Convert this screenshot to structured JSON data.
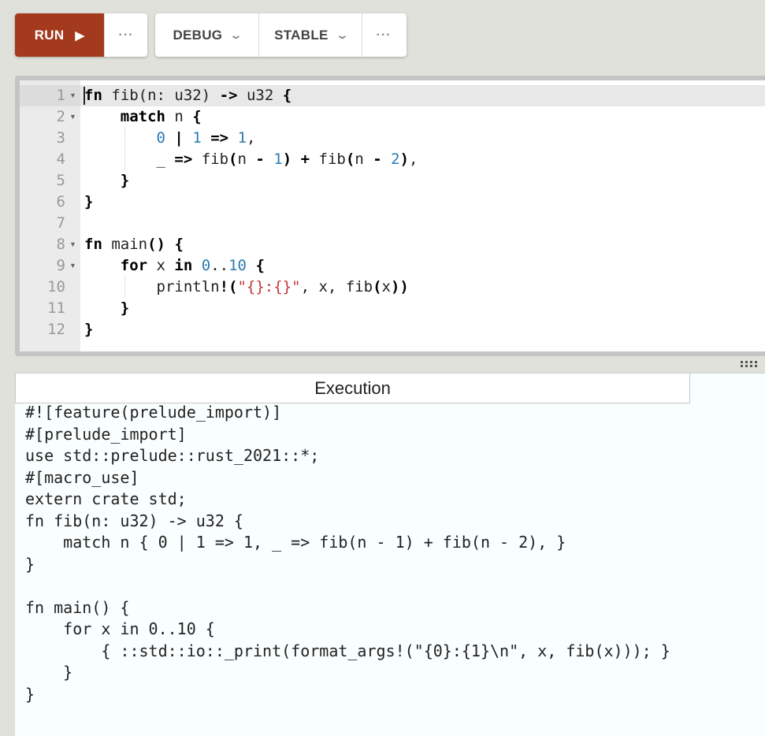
{
  "toolbar": {
    "run_label": "RUN",
    "more_label": "···",
    "mode_label": "DEBUG",
    "channel_label": "STABLE",
    "advanced_more_label": "···"
  },
  "editor": {
    "line_numbers": [
      "1",
      "2",
      "3",
      "4",
      "5",
      "6",
      "7",
      "8",
      "9",
      "10",
      "11",
      "12"
    ],
    "fold_lines": [
      1,
      2,
      8,
      9
    ]
  },
  "output": {
    "tab_label": "Execution",
    "lines": [
      "#![feature(prelude_import)]",
      "#[prelude_import]",
      "use std::prelude::rust_2021::*;",
      "#[macro_use]",
      "extern crate std;",
      "fn fib(n: u32) -> u32 {",
      "    match n { 0 | 1 => 1, _ => fib(n - 1) + fib(n - 2), }",
      "}",
      "",
      "fn main() {",
      "    for x in 0..10 {",
      "        { ::std::io::_print(format_args!(\"{0}:{1}\\n\", x, fib(x))); }",
      "    }",
      "}"
    ]
  }
}
